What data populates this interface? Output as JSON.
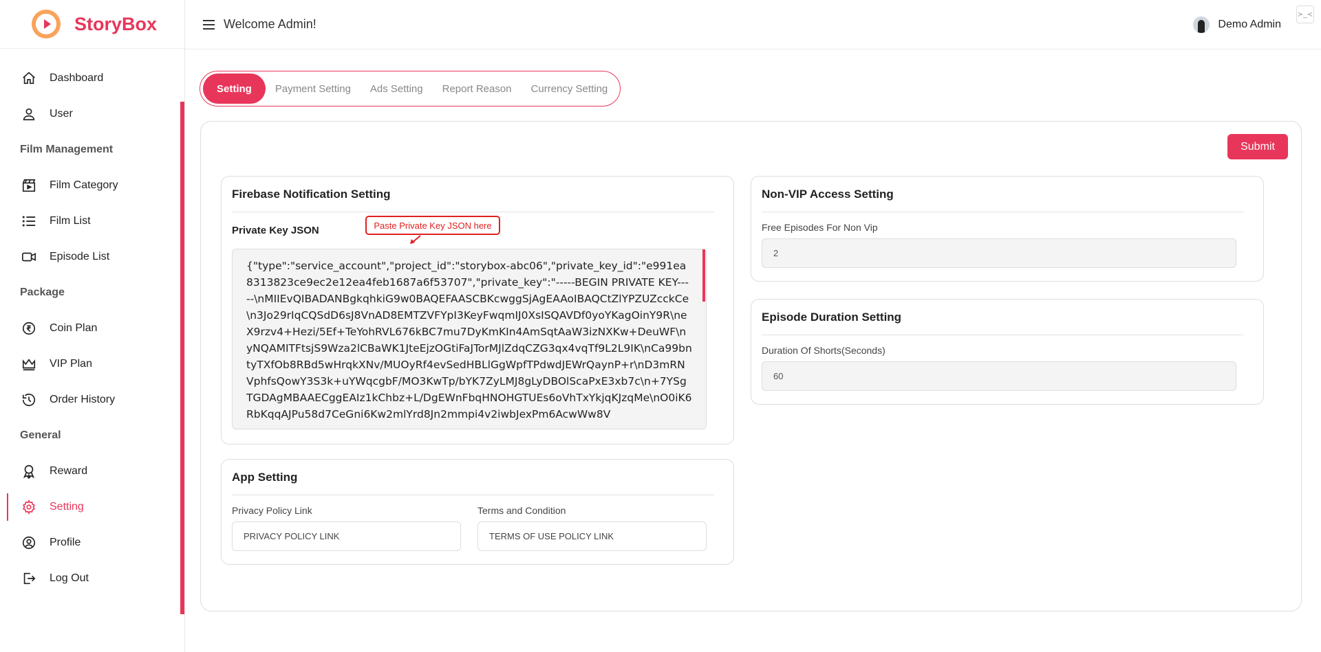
{
  "brand": {
    "name": "StoryBox"
  },
  "topbar": {
    "welcome": "Welcome Admin!",
    "user_name": "Demo Admin"
  },
  "sidebar": {
    "items": [
      {
        "label": "Dashboard"
      },
      {
        "label": "User"
      },
      {
        "section": "Film Management"
      },
      {
        "label": "Film Category"
      },
      {
        "label": "Film List"
      },
      {
        "label": "Episode List"
      },
      {
        "section": "Package"
      },
      {
        "label": "Coin Plan"
      },
      {
        "label": "VIP Plan"
      },
      {
        "label": "Order History"
      },
      {
        "section": "General"
      },
      {
        "label": "Reward"
      },
      {
        "label": "Setting"
      },
      {
        "label": "Profile"
      },
      {
        "label": "Log Out"
      }
    ],
    "active": "Setting"
  },
  "tabs": [
    {
      "label": "Setting"
    },
    {
      "label": "Payment Setting"
    },
    {
      "label": "Ads Setting"
    },
    {
      "label": "Report Reason"
    },
    {
      "label": "Currency Setting"
    }
  ],
  "submit_label": "Submit",
  "firebase": {
    "title": "Firebase Notification Setting",
    "key_label": "Private Key JSON",
    "tooltip": "Paste Private Key JSON here",
    "key_value": "{\"type\":\"service_account\",\"project_id\":\"storybox-abc06\",\"private_key_id\":\"e991ea8313823ce9ec2e12ea4feb1687a6f53707\",\"private_key\":\"-----BEGIN PRIVATE KEY-----\\nMIIEvQIBADANBgkqhkiG9w0BAQEFAASCBKcwggSjAgEAAoIBAQCtZlYPZUZcckCe\\n3Jo29rIqCQSdD6sJ8VnAD8EMTZVFYpI3KeyFwqmIJ0XsISQAVDf0yoYKagOinY9R\\neX9rzv4+Hezi/5Ef+TeYohRVL676kBC7mu7DyKmKIn4AmSqtAaW3izNXKw+DeuWF\\nyNQAMITFtsjS9Wza2lCBaWK1JteEjzOGtiFaJTorMJlZdqCZG3qx4vqTf9L2L9IK\\nCa99bntyTXfOb8RBd5wHrqkXNv/MUOyRf4evSedHBLlGgWpfTPdwdJEWrQaynP+r\\nD3mRNVphfsQowY3S3k+uYWqcgbF/MO3KwTp/bYK7ZyLMJ8gLyDBOlScaPxE3xb7c\\n+7YSgTGDAgMBAAECggEAIz1kChbz+L/DgEWnFbqHNOHGTUEs6oVhTxYkjqKJzqMe\\nO0iK6RbKqqAJPu58d7CeGni6Kw2mlYrd8Jn2mmpi4v2iwbJexPm6AcwWw8V"
  },
  "app": {
    "title": "App Setting",
    "privacy_label": "Privacy Policy Link",
    "privacy_placeholder": "PRIVACY POLICY LINK",
    "terms_label": "Terms and Condition",
    "terms_placeholder": "TERMS OF USE POLICY LINK"
  },
  "nonvip": {
    "title": "Non-VIP Access Setting",
    "label": "Free Episodes For Non Vip",
    "value": "2"
  },
  "episode": {
    "title": "Episode Duration Setting",
    "label": "Duration Of Shorts(Seconds)",
    "value": "60"
  },
  "colors": {
    "accent": "#e8365b"
  }
}
